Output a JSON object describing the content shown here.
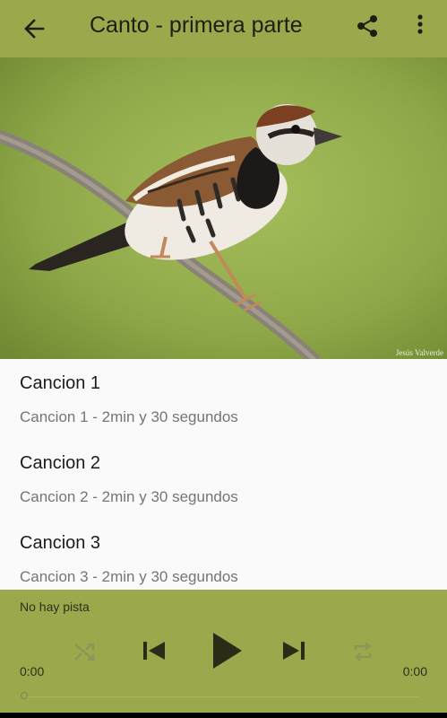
{
  "toolbar": {
    "title": "Canto - primera parte",
    "back_icon": "arrow-back-icon",
    "share_icon": "share-icon",
    "more_icon": "more-vert-icon"
  },
  "hero": {
    "credit": "Jesús Valverde"
  },
  "tracks": [
    {
      "title": "Cancion 1",
      "subtitle": "Cancion 1 - 2min y 30 segundos"
    },
    {
      "title": "Cancion 2",
      "subtitle": "Cancion 2 - 2min y 30 segundos"
    },
    {
      "title": "Cancion 3",
      "subtitle": "Cancion 3 - 2min y 30 segundos"
    }
  ],
  "player": {
    "status": "No hay pista",
    "elapsed": "0:00",
    "duration": "0:00",
    "progress": 0,
    "controls": [
      "shuffle-icon",
      "skip-previous-icon",
      "play-icon",
      "skip-next-icon",
      "repeat-icon"
    ]
  },
  "colors": {
    "accent": "#9ca84c",
    "text_primary": "#1b1b1b",
    "text_secondary": "#757575"
  }
}
